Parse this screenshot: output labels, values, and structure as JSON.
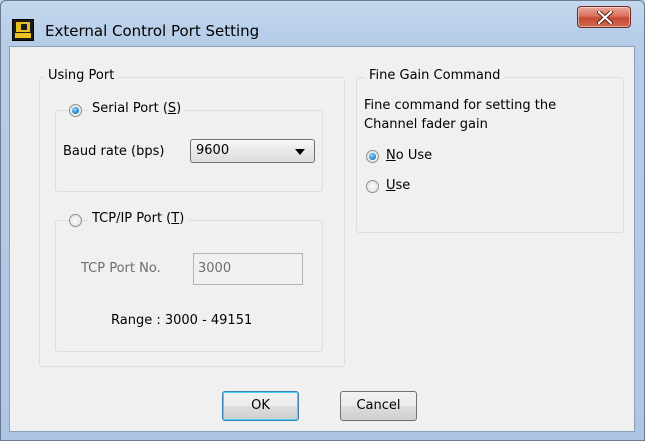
{
  "window": {
    "title": "External Control Port Setting"
  },
  "using_port": {
    "legend": "Using Port",
    "serial": {
      "label": "Serial Port (",
      "mnemonic": "S",
      "suffix": ")",
      "checked": true
    },
    "baud": {
      "label": "Baud rate (bps)",
      "value": "9600"
    },
    "tcp": {
      "label": "TCP/IP Port (",
      "mnemonic": "T",
      "suffix": ")",
      "checked": false
    },
    "tcp_port": {
      "label": "TCP Port No.",
      "value": "3000"
    },
    "range_text": "Range : 3000 - 49151"
  },
  "fine_gain": {
    "legend": "Fine Gain Command",
    "description_line1": "Fine command for setting the",
    "description_line2": "Channel fader gain",
    "no_use": {
      "mnemonic": "N",
      "rest": "o Use",
      "checked": true
    },
    "use": {
      "mnemonic": "U",
      "rest": "se",
      "checked": false
    }
  },
  "buttons": {
    "ok": "OK",
    "cancel": "Cancel"
  }
}
